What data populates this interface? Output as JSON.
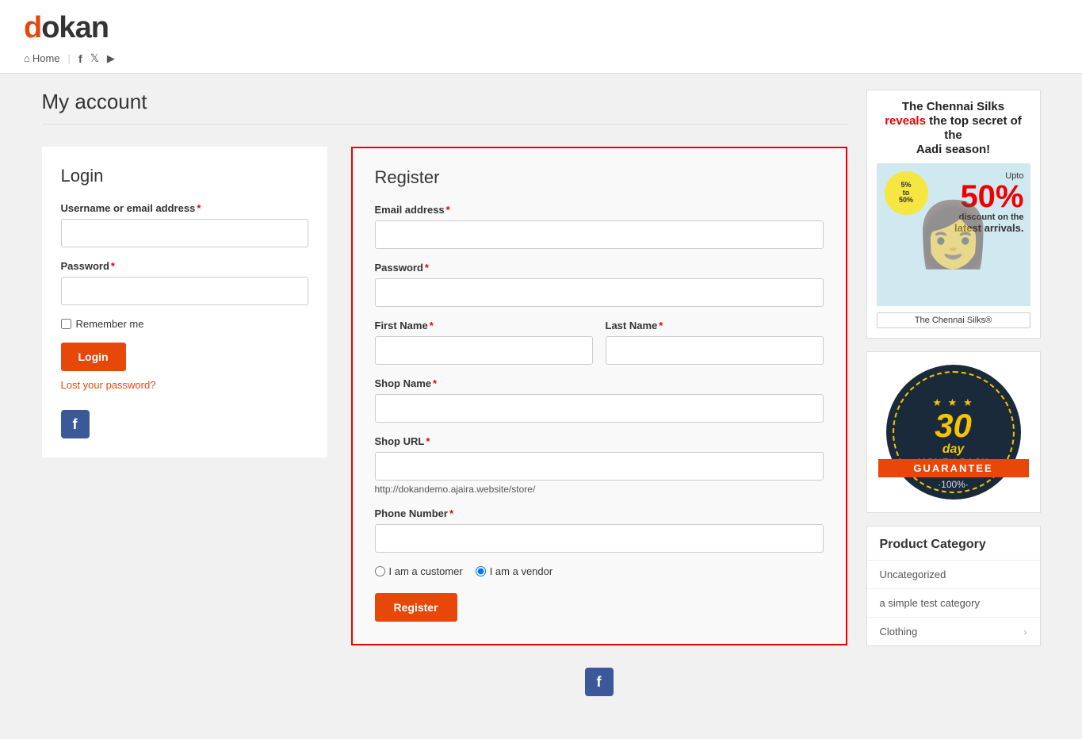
{
  "header": {
    "logo_d": "d",
    "logo_rest": "okan",
    "nav": {
      "home_label": "Home",
      "home_icon": "⌂",
      "facebook_icon": "f",
      "twitter_icon": "t",
      "youtube_icon": "▶"
    }
  },
  "page": {
    "title": "My account"
  },
  "login": {
    "section_title": "Login",
    "username_label": "Username or email address",
    "password_label": "Password",
    "remember_label": "Remember me",
    "login_btn": "Login",
    "lost_password": "Lost your password?",
    "fb_label": "f"
  },
  "register": {
    "section_title": "Register",
    "email_label": "Email address",
    "password_label": "Password",
    "first_name_label": "First Name",
    "last_name_label": "Last Name",
    "shop_name_label": "Shop Name",
    "shop_url_label": "Shop URL",
    "shop_url_hint": "http://dokandemo.ajaira.website/store/",
    "phone_label": "Phone Number",
    "customer_radio": "I am a customer",
    "vendor_radio": "I am a vendor",
    "register_btn": "Register",
    "fb_label": "f"
  },
  "sidebar": {
    "ad": {
      "title_1": "The Chennai Silks",
      "title_2": "reveals",
      "title_3": "the top secret of the",
      "title_4": "Aadi season!",
      "discount_big": "50%",
      "discount_sub": "discount on the",
      "discount_sub2": "latest arrivals.",
      "logo_text": "The Chennai Silks®"
    },
    "guarantee": {
      "days": "30",
      "day_label": "day",
      "money": "MONEY BACK",
      "guarantee": "GUARANTEE",
      "percent": "·100%·"
    },
    "product_category": {
      "title": "Product Category",
      "items": [
        {
          "name": "Uncategorized",
          "has_arrow": false
        },
        {
          "name": "a simple test category",
          "has_arrow": false
        },
        {
          "name": "Clothing",
          "has_arrow": true
        }
      ]
    }
  }
}
